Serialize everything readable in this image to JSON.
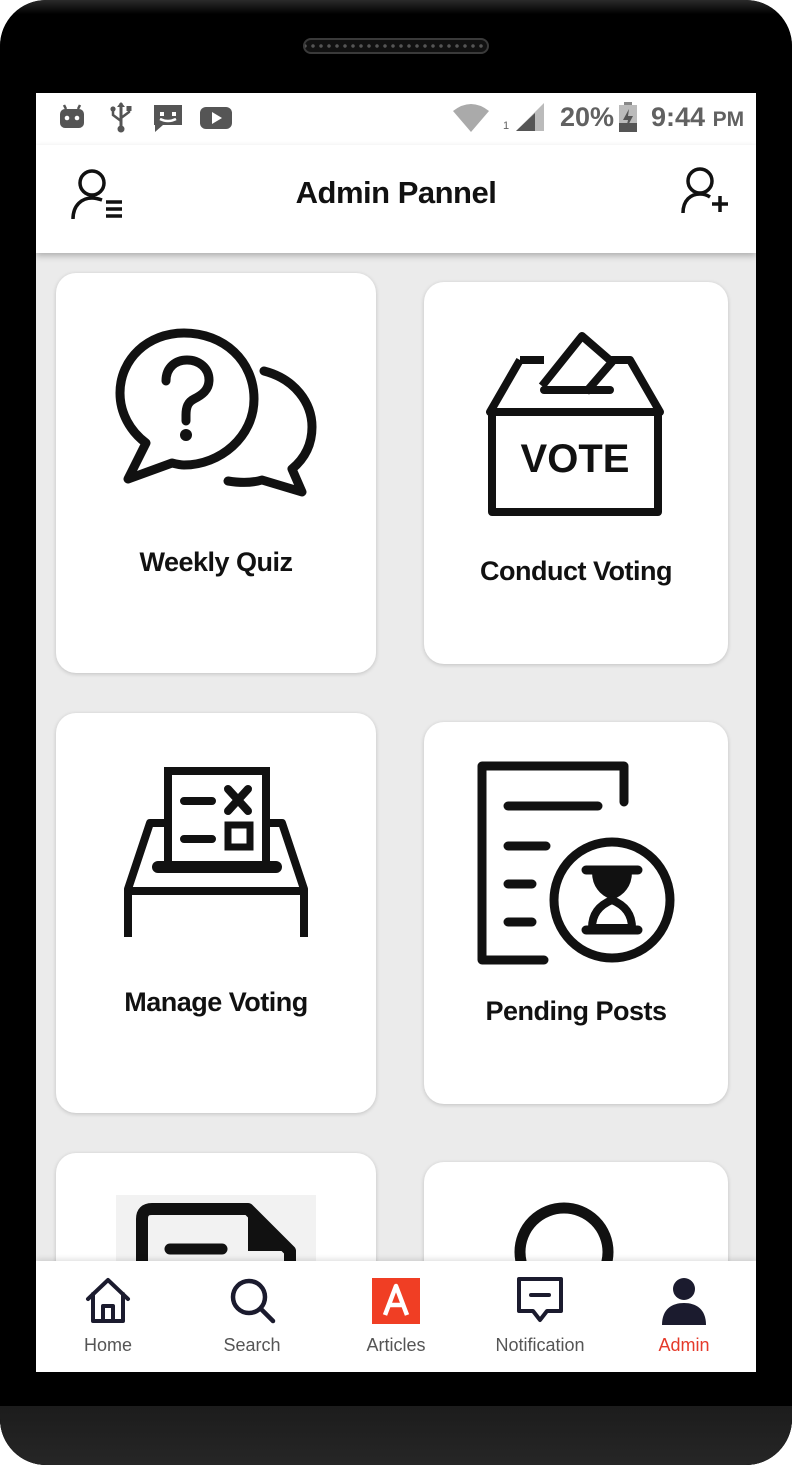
{
  "status_bar": {
    "battery": "20%",
    "time": "9:44",
    "ampm": "PM",
    "sim_slot": "1"
  },
  "appbar": {
    "title": "Admin Pannel"
  },
  "cards": [
    {
      "label": "Weekly Quiz",
      "icon": "quiz-chat-icon"
    },
    {
      "label": "Conduct Voting",
      "icon": "ballot-box-icon"
    },
    {
      "label": "Manage Voting",
      "icon": "ballot-paper-icon"
    },
    {
      "label": "Pending Posts",
      "icon": "pending-document-icon"
    },
    {
      "label": "",
      "icon": "document-icon"
    },
    {
      "label": "",
      "icon": "user-icon"
    }
  ],
  "nav": [
    {
      "label": "Home",
      "icon": "home-icon"
    },
    {
      "label": "Search",
      "icon": "search-icon"
    },
    {
      "label": "Articles",
      "icon": "articles-icon"
    },
    {
      "label": "Notification",
      "icon": "notification-icon"
    },
    {
      "label": "Admin",
      "icon": "admin-icon",
      "active": true
    }
  ],
  "colors": {
    "accent": "#e53a2a",
    "background": "#ebebeb",
    "card": "#ffffff"
  }
}
